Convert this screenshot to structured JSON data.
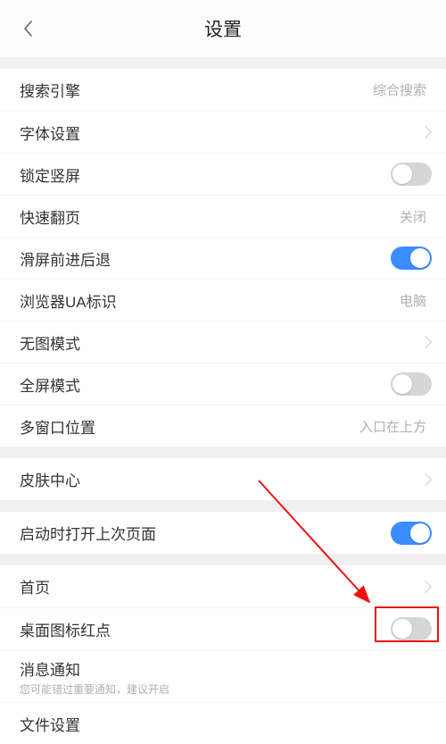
{
  "header": {
    "title": "设置"
  },
  "rows": {
    "search_engine": {
      "label": "搜索引擎",
      "value": "综合搜索"
    },
    "font": {
      "label": "字体设置"
    },
    "lock_portrait": {
      "label": "锁定竖屏"
    },
    "fast_flip": {
      "label": "快速翻页",
      "value": "关闭"
    },
    "swipe_nav": {
      "label": "滑屏前进后退"
    },
    "ua": {
      "label": "浏览器UA标识",
      "value": "电脑"
    },
    "no_image": {
      "label": "无图模式"
    },
    "fullscreen": {
      "label": "全屏模式"
    },
    "multi_window": {
      "label": "多窗口位置",
      "value": "入口在上方"
    },
    "skin": {
      "label": "皮肤中心"
    },
    "open_last": {
      "label": "启动时打开上次页面"
    },
    "homepage": {
      "label": "首页"
    },
    "badge": {
      "label": "桌面图标红点"
    },
    "notif": {
      "label": "消息通知",
      "sub": "您可能错过重要通知，建议开启"
    },
    "file": {
      "label": "文件设置"
    }
  }
}
